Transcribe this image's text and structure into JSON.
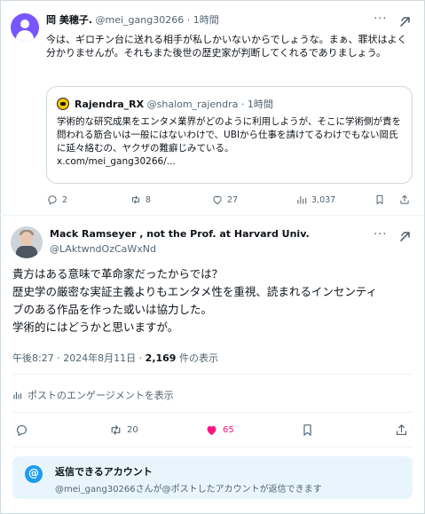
{
  "reply_tweet": {
    "author_name": "岡 美穂子.",
    "author_handle": "@mei_gang30266",
    "time": "· 1時間",
    "text": "今は、ギロチン台に送れる相手が私しかいないからでしょうな。まぁ、罪状はよく分かりませんが。それもまた後世の歴史家が判断してくれるでありましょう。",
    "quote": {
      "author_name": "Rajendra_RX",
      "author_handle": "@shalom_rajendra",
      "time": "· 1時間",
      "text": "学術的な研究成果をエンタメ業界がどのように利用しようが、そこに学術側が責を問われる筋合いは一般にはないわけで、UBIから仕事を請けてるわけでもない岡氏に延々絡むの、ヤクザの難癖じみている。",
      "link": "x.com/mei_gang30266/..."
    },
    "actions": {
      "replies": "2",
      "reposts": "8",
      "likes": "27",
      "views": "3,037"
    }
  },
  "main_tweet": {
    "author_name": "Mack Ramseyer , not the Prof. at Harvard Univ.",
    "author_handle": "@LAktwndOzCaWxNd",
    "text_lines": [
      "貴方はある意味で革命家だったからでは？",
      "歴史学の厳密な実証主義よりもエンタメ性を重視、読まれるインセンティ",
      "ブのある作品を作った或いは協力した。",
      "学術的にはどうかと思いますが。"
    ],
    "timestamp": "午後8:27 · 2024年8月11日 · ",
    "view_count": "2,169",
    "view_suffix": " 件の表示",
    "engagement_link": "ポストのエンゲージメントを表示",
    "actions": {
      "reposts": "20",
      "likes": "65"
    }
  },
  "reply_permission": {
    "title": "返信できるアカウント",
    "subtitle": "@mei_gang30266さんが@ポストしたアカウントが返信できます",
    "icon_glyph": "@"
  },
  "colors": {
    "accent": "#1d9bf0",
    "like_active": "#f91880",
    "muted_text": "#536471"
  }
}
